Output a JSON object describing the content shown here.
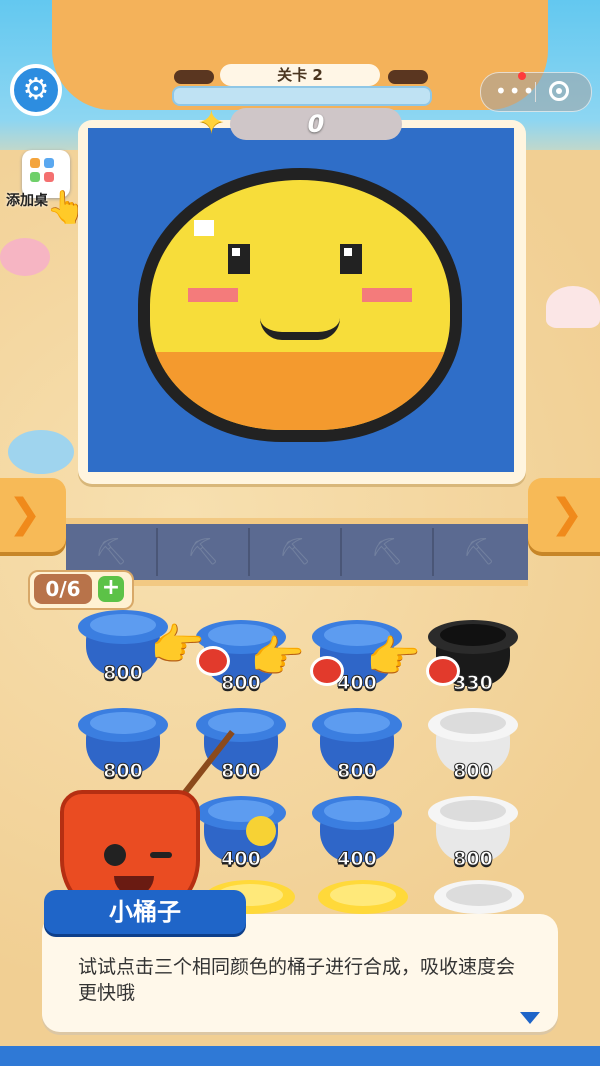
{
  "header": {
    "level_title": "关卡 2",
    "score": "0"
  },
  "sidebar": {
    "add_to_desktop_label": "添加桌"
  },
  "counter": {
    "value": "0/6",
    "plus": "+"
  },
  "buckets": [
    {
      "color": "blue",
      "label": "800",
      "open": true
    },
    {
      "color": "blue",
      "label": "800",
      "open": true
    },
    {
      "color": "blue",
      "label": "400",
      "open": true
    },
    {
      "color": "black",
      "label": "330",
      "open": true
    },
    {
      "color": "blue",
      "label": "800",
      "open": false
    },
    {
      "color": "blue",
      "label": "800",
      "open": false
    },
    {
      "color": "blue",
      "label": "800",
      "open": false
    },
    {
      "color": "white",
      "label": "800",
      "open": false
    },
    {
      "color": "blue",
      "label": "400",
      "open": false
    },
    {
      "color": "blue",
      "label": "400",
      "open": false
    },
    {
      "color": "white",
      "label": "800",
      "open": false
    }
  ],
  "dialog": {
    "speaker": "小桶子",
    "text": "试试点击三个相同颜色的桶子进行合成，吸收速度会更快哦"
  },
  "icons": {
    "settings": "gear-icon",
    "star": "star-icon",
    "left_arrow": "chevron-left-icon",
    "right_arrow": "chevron-right-icon",
    "shovel": "shovel-icon",
    "hand": "pointing-hand-icon",
    "menu": "more-dots-icon",
    "close": "target-circle-icon"
  },
  "colors": {
    "accent": "#1f65c8",
    "sky": "#63c8f0",
    "sand": "#f3d39a",
    "bucket_blue": "#3b7ee0"
  }
}
